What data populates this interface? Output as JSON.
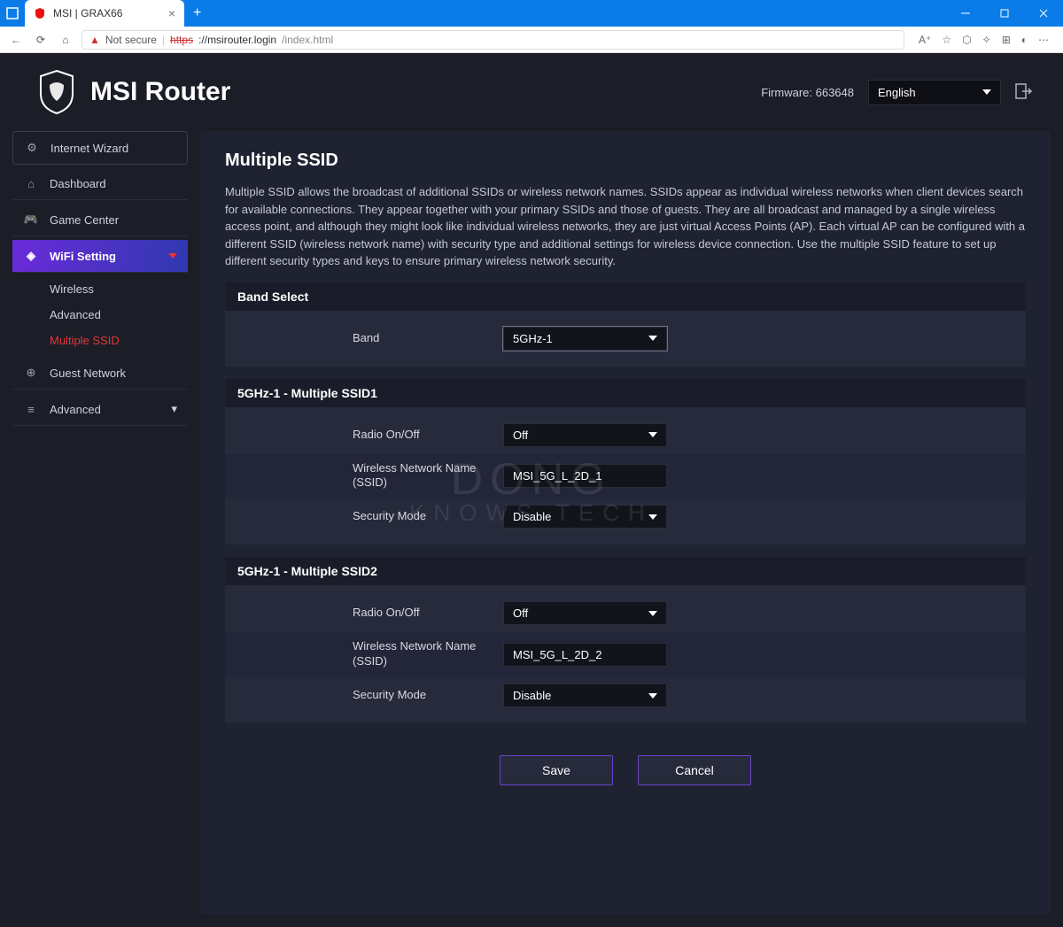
{
  "browser": {
    "tab_title": "MSI | GRAX66",
    "not_secure": "Not secure",
    "url_proto": "https",
    "url_host": "://msirouter.login",
    "url_path": "/index.html"
  },
  "header": {
    "brand": "MSI Router",
    "firmware_label": "Firmware: 663648",
    "language": "English"
  },
  "sidebar": {
    "wizard": "Internet Wizard",
    "dashboard": "Dashboard",
    "game": "Game Center",
    "wifi": "WiFi Setting",
    "sub_wireless": "Wireless",
    "sub_advanced": "Advanced",
    "sub_mssid": "Multiple SSID",
    "guest": "Guest Network",
    "advanced": "Advanced"
  },
  "main": {
    "title": "Multiple SSID",
    "desc": "Multiple SSID allows the broadcast of additional SSIDs or wireless network names. SSIDs appear as individual wireless networks when client devices search for available connections. They appear together with your primary SSIDs and those of guests. They are all broadcast and managed by a single wireless access point, and although they might look like individual wireless networks, they are just virtual Access Points (AP). Each virtual AP can be configured with a different SSID (wireless network name) with security type and additional settings for wireless device connection. Use the multiple SSID feature to set up different security types and keys to ensure primary wireless network security.",
    "band_select_title": "Band Select",
    "band_label": "Band",
    "band_value": "5GHz-1",
    "ssid1": {
      "title": "5GHz-1 - Multiple SSID1",
      "radio_label": "Radio On/Off",
      "radio_value": "Off",
      "name_label": "Wireless Network Name (SSID)",
      "name_value": "MSI_5G_L_2D_1",
      "sec_label": "Security Mode",
      "sec_value": "Disable"
    },
    "ssid2": {
      "title": "5GHz-1 - Multiple SSID2",
      "radio_label": "Radio On/Off",
      "radio_value": "Off",
      "name_label": "Wireless Network Name (SSID)",
      "name_value": "MSI_5G_L_2D_2",
      "sec_label": "Security Mode",
      "sec_value": "Disable"
    },
    "save": "Save",
    "cancel": "Cancel"
  },
  "watermark": {
    "l1": "DONG",
    "l2": "KNOWS TECH"
  }
}
